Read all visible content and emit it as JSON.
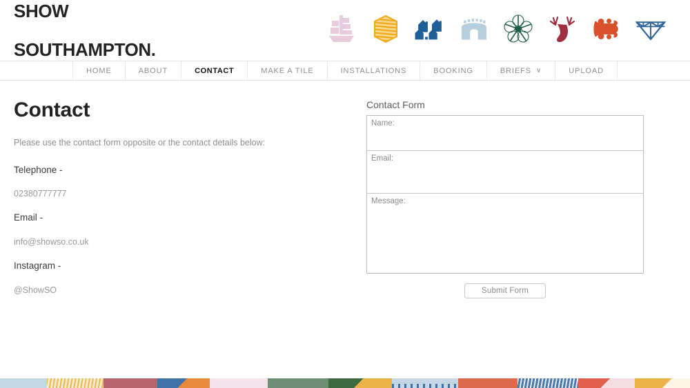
{
  "header": {
    "logo_line1": "SHOW",
    "logo_line2": "SOUTHAMPTON.",
    "brand_icons": [
      {
        "name": "ship-icon",
        "color": "#e8cbdd"
      },
      {
        "name": "hay-bale-icon",
        "color": "#f0a818"
      },
      {
        "name": "houses-icon",
        "color": "#1f5e96"
      },
      {
        "name": "bargate-icon",
        "color": "#b6cedd"
      },
      {
        "name": "flower-icon",
        "color": "#1d5c46"
      },
      {
        "name": "stag-icon",
        "color": "#9e3040"
      },
      {
        "name": "puzzle-icon",
        "color": "#d8512a"
      },
      {
        "name": "bridge-truss-icon",
        "color": "#2f6596"
      }
    ]
  },
  "nav": {
    "items": [
      {
        "label": "HOME",
        "active": false
      },
      {
        "label": "ABOUT",
        "active": false
      },
      {
        "label": "CONTACT",
        "active": true
      },
      {
        "label": "MAKE A TILE",
        "active": false
      },
      {
        "label": "INSTALLATIONS",
        "active": false
      },
      {
        "label": "BOOKING",
        "active": false
      },
      {
        "label": "BRIEFS",
        "active": false,
        "chevron": "∨"
      },
      {
        "label": "UPLOAD",
        "active": false
      }
    ]
  },
  "main": {
    "page_title": "Contact",
    "intro": "Please use the contact form opposite or the contact details below:",
    "details": [
      {
        "label": "Telephone -",
        "value": "02380777777"
      },
      {
        "label": "Email -",
        "value": "info@showso.co.uk"
      },
      {
        "label": "Instagram -",
        "value": "@ShowSO"
      }
    ]
  },
  "form": {
    "title": "Contact Form",
    "fields": [
      {
        "label": "Name:",
        "value": ""
      },
      {
        "label": "Email:",
        "value": ""
      },
      {
        "label": "Message:",
        "value": ""
      }
    ],
    "submit_label": "Submit Form"
  },
  "footer": {
    "tiles": [
      {
        "name": "tile-pale-blue",
        "color": "#c3d9e5",
        "width": 68,
        "pattern": "solid"
      },
      {
        "name": "tile-cream-stripes",
        "color": "#f3ead4",
        "width": 82,
        "pattern": "stripes",
        "accent": "#e9b94a"
      },
      {
        "name": "tile-rose",
        "color": "#b9646d",
        "width": 78,
        "pattern": "solid"
      },
      {
        "name": "tile-orange-blue",
        "color": "#e98a3a",
        "width": 76,
        "pattern": "blocks",
        "accent": "#3f72a8"
      },
      {
        "name": "tile-blush",
        "color": "#f4e3ea",
        "width": 84,
        "pattern": "solid"
      },
      {
        "name": "tile-sage-green",
        "color": "#6e8f74",
        "width": 88,
        "pattern": "solid"
      },
      {
        "name": "tile-amber",
        "color": "#edb349",
        "width": 92,
        "pattern": "blocks",
        "accent": "#3d6b3f"
      },
      {
        "name": "tile-pale-blue-2",
        "color": "#c6d8e6",
        "width": 96,
        "pattern": "dots",
        "accent": "#3f72a8"
      },
      {
        "name": "tile-terracotta",
        "color": "#dd6a4c",
        "width": 86,
        "pattern": "solid"
      },
      {
        "name": "tile-steel-blue",
        "color": "#4d78a8",
        "width": 88,
        "pattern": "stripes",
        "accent": "#e8eef3"
      },
      {
        "name": "tile-pink-hearts",
        "color": "#f5dde2",
        "width": 82,
        "pattern": "blocks",
        "accent": "#e0604c"
      },
      {
        "name": "tile-gold-arrows",
        "color": "#fdf6e6",
        "width": 98,
        "pattern": "blocks",
        "accent": "#edb349"
      },
      {
        "name": "tile-ice-blue",
        "color": "#c3d9e5",
        "width": 82,
        "pattern": "solid"
      }
    ]
  }
}
